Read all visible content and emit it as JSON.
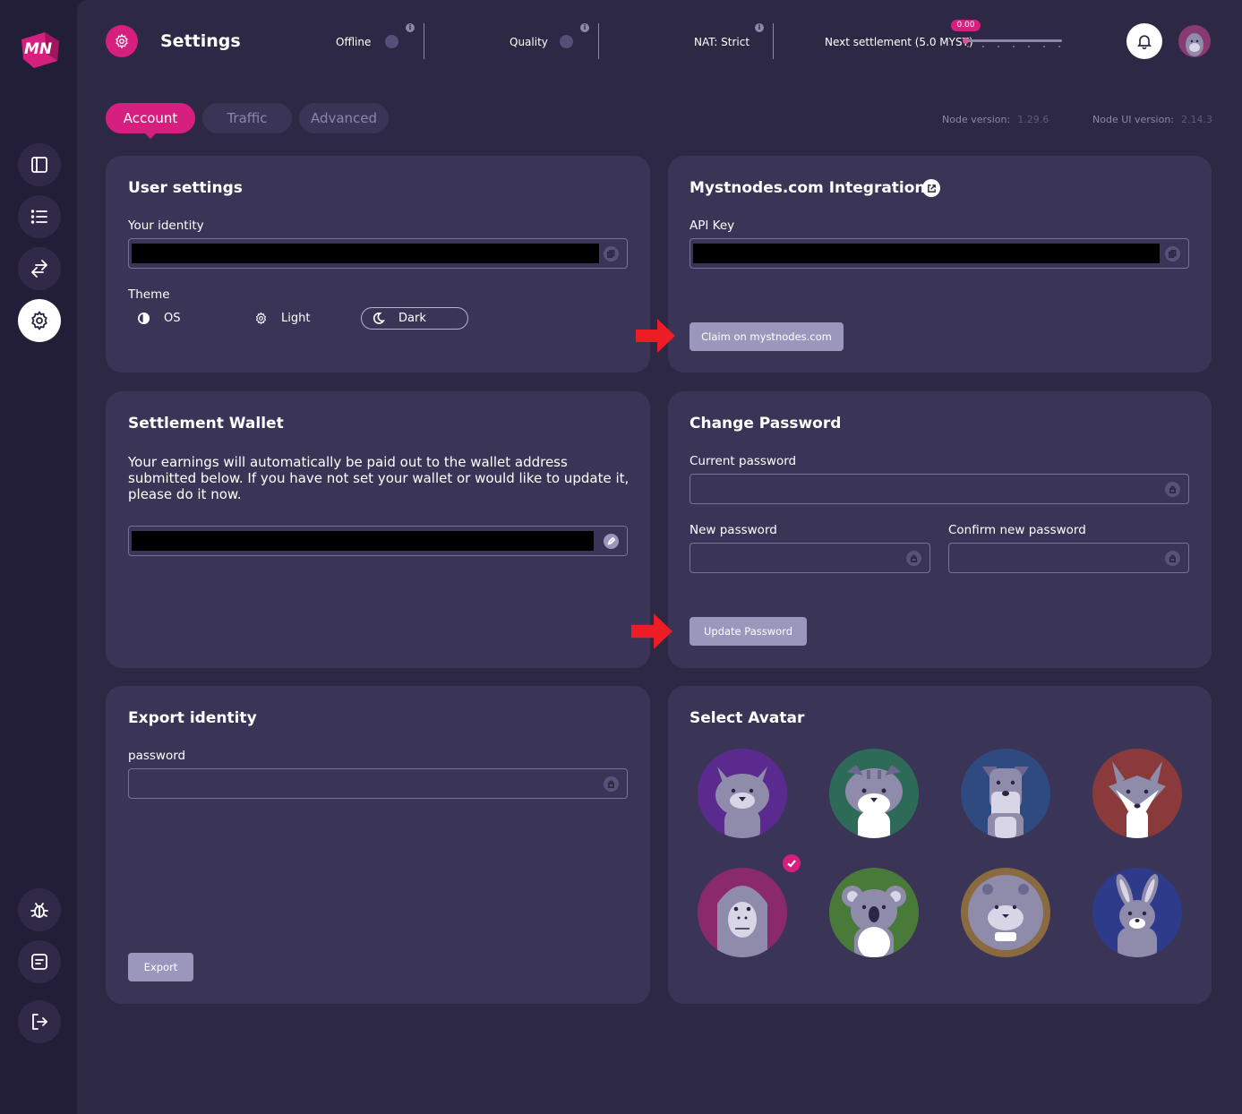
{
  "app": {
    "logo_text": "MN"
  },
  "header": {
    "title": "Settings",
    "status_offline": "Offline",
    "status_quality": "Quality",
    "nat_label": "NAT:",
    "nat_value": "Strict",
    "settlement_label": "Next settlement (5.0 MYST)",
    "settlement_value": "0.00",
    "settlement_progress": 0.0
  },
  "tabs": [
    {
      "label": "Account",
      "active": true
    },
    {
      "label": "Traffic",
      "active": false
    },
    {
      "label": "Advanced",
      "active": false
    }
  ],
  "versions": {
    "node_label": "Node version:",
    "node_value": "1.29.6",
    "ui_label": "Node UI version:",
    "ui_value": "2.14.3"
  },
  "user_settings": {
    "title": "User settings",
    "identity_label": "Your identity",
    "theme_label": "Theme",
    "theme_options": [
      "OS",
      "Light",
      "Dark"
    ],
    "theme_selected": "Dark"
  },
  "integrations": {
    "title": "Mystnodes.com Integrations",
    "api_key_label": "API Key",
    "claim_button": "Claim on mystnodes.com"
  },
  "settlement_wallet": {
    "title": "Settlement Wallet",
    "description": "Your earnings will automatically be paid out to the wallet address submitted below. If you have not set your wallet or would like to update it, please do it now."
  },
  "change_password": {
    "title": "Change Password",
    "current_label": "Current password",
    "new_label": "New password",
    "confirm_label": "Confirm new password",
    "update_button": "Update Password"
  },
  "export_identity": {
    "title": "Export identity",
    "password_label": "password",
    "export_button": "Export"
  },
  "avatar": {
    "title": "Select Avatar",
    "options": [
      "cat",
      "tiger-cat",
      "schnauzer",
      "fox",
      "gorilla",
      "koala",
      "hamster",
      "rabbit"
    ],
    "selected": "gorilla"
  },
  "colors": {
    "accent": "#d61f7f",
    "background": "#2d2843",
    "card": "#3a3556",
    "sidebar": "#221e37",
    "button": "#9b96bb"
  }
}
